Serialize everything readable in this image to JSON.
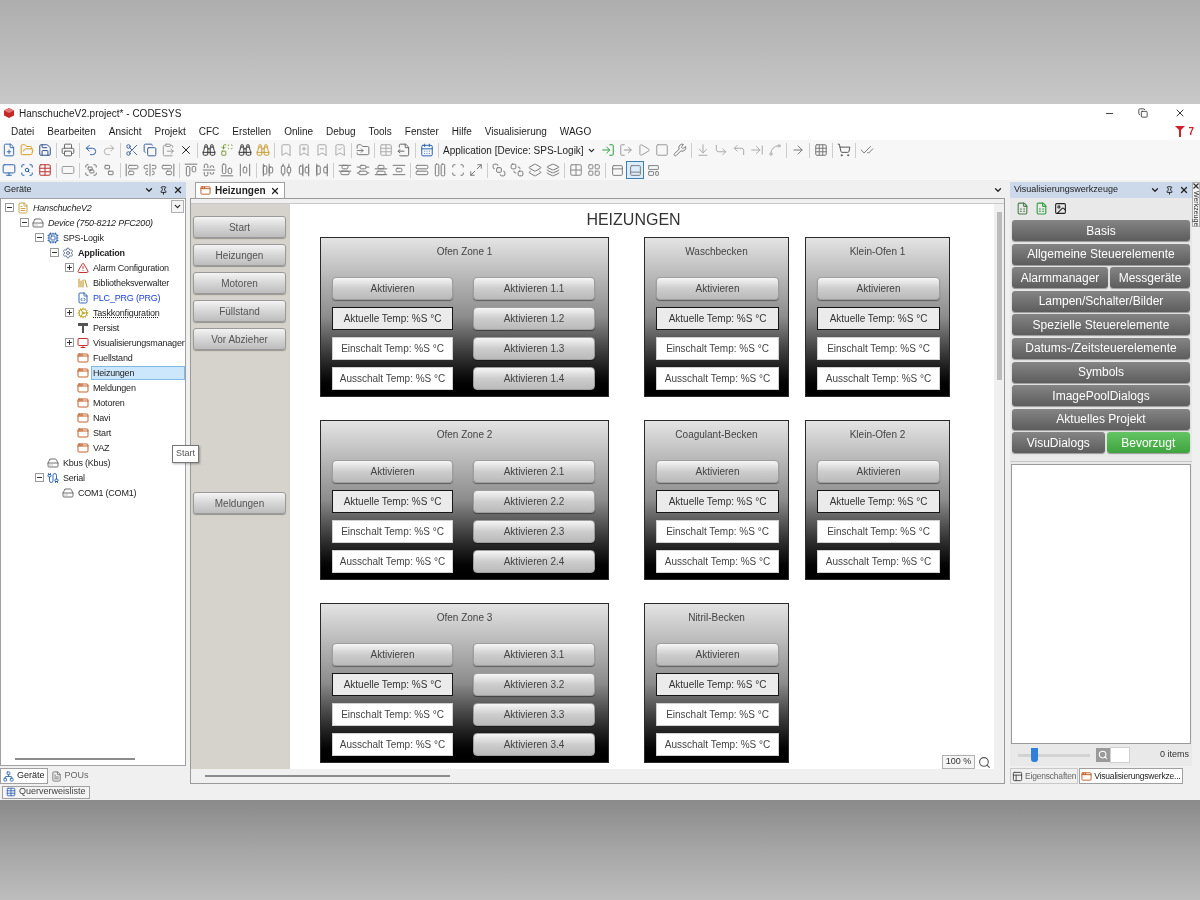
{
  "window": {
    "title": "HanschucheV2.project* - CODESYS"
  },
  "menu_bar": {
    "items": [
      "Datei",
      "Bearbeiten",
      "Ansicht",
      "Projekt",
      "CFC",
      "Erstellen",
      "Online",
      "Debug",
      "Tools",
      "Fenster",
      "Hilfe",
      "Visualisierung",
      "WAGO"
    ],
    "badge": "7"
  },
  "toolbar": {
    "application_selector": "Application [Device: SPS-Logik]",
    "layout_toggles": [
      {
        "selected": false
      },
      {
        "selected": true
      },
      {
        "selected": false
      }
    ]
  },
  "devices_panel": {
    "title": "Geräte",
    "tree": [
      {
        "label": "HanschucheV2",
        "kind": "project",
        "expanded": true,
        "selected": false,
        "children": [
          {
            "label": "Device (750-8212 PFC200)",
            "kind": "device",
            "expanded": true,
            "selected": false,
            "children": [
              {
                "label": "SPS-Logik",
                "kind": "plc-logic",
                "expanded": true,
                "selected": false,
                "children": [
                  {
                    "label": "Application",
                    "kind": "application",
                    "expanded": true,
                    "selected": false,
                    "children": [
                      {
                        "label": "Alarm Configuration",
                        "kind": "alarm",
                        "expanded": false,
                        "selected": false
                      },
                      {
                        "label": "Bibliotheksverwalter",
                        "kind": "library",
                        "selected": false
                      },
                      {
                        "label": "PLC_PRG (PRG)",
                        "kind": "program",
                        "selected": false
                      },
                      {
                        "label": "Taskkonfiguration",
                        "kind": "tasks",
                        "expanded": false,
                        "selected": false
                      },
                      {
                        "label": "Persist",
                        "kind": "persist",
                        "selected": false
                      },
                      {
                        "label": "Visualisierungsmanager",
                        "kind": "visu-manager",
                        "expanded": false,
                        "selected": false
                      },
                      {
                        "label": "Fuellstand",
                        "kind": "visualization",
                        "selected": false
                      },
                      {
                        "label": "Heizungen",
                        "kind": "visualization",
                        "selected": true
                      },
                      {
                        "label": "Meldungen",
                        "kind": "visualization",
                        "selected": false
                      },
                      {
                        "label": "Motoren",
                        "kind": "visualization",
                        "selected": false
                      },
                      {
                        "label": "Navi",
                        "kind": "visualization",
                        "selected": false
                      },
                      {
                        "label": "Start",
                        "kind": "visualization",
                        "selected": false
                      },
                      {
                        "label": "VAZ",
                        "kind": "visualization",
                        "selected": false
                      }
                    ]
                  }
                ]
              },
              {
                "label": "Kbus (Kbus)",
                "kind": "bus",
                "selected": false
              },
              {
                "label": "Serial",
                "kind": "serial",
                "expanded": true,
                "selected": false,
                "children": [
                  {
                    "label": "COM1 (COM1)",
                    "kind": "port",
                    "selected": false
                  }
                ]
              }
            ]
          }
        ]
      }
    ],
    "tabs": [
      {
        "label": "Geräte",
        "selected": true
      },
      {
        "label": "POUs",
        "selected": false
      }
    ]
  },
  "bottom_dock": {
    "tab": "Querverweisliste"
  },
  "tooltip": {
    "text": "Start"
  },
  "editor": {
    "tabs": [
      {
        "label": "Heizungen",
        "selected": true
      }
    ],
    "nav_buttons": [
      "Start",
      "Heizungen",
      "Motoren",
      "Füllstand",
      "Vor Abzieher"
    ],
    "nav_buttons_lower": [
      "Meldungen"
    ],
    "title": "HEIZUNGEN",
    "panel_rows": [
      [
        {
          "title": "Ofen Zone 1",
          "kind": "zone",
          "activate_button": "Aktivieren",
          "fields": [
            {
              "label": "Aktuelle Temp: %S °C",
              "kind": "readout"
            },
            {
              "label": "Einschalt Temp: %S °C",
              "kind": "setpoint"
            },
            {
              "label": "Ausschalt Temp: %S °C",
              "kind": "setpoint"
            }
          ],
          "stage_buttons": [
            "Aktivieren 1.1",
            "Aktivieren 1.2",
            "Aktivieren 1.3",
            "Aktivieren 1.4"
          ]
        },
        {
          "title": "Waschbecken",
          "kind": "unit",
          "activate_button": "Aktivieren",
          "fields": [
            {
              "label": "Aktuelle Temp: %S °C",
              "kind": "readout"
            },
            {
              "label": "Einschalt Temp: %S °C",
              "kind": "setpoint"
            },
            {
              "label": "Ausschalt Temp: %S °C",
              "kind": "setpoint"
            }
          ]
        },
        {
          "title": "Klein-Ofen 1",
          "kind": "unit",
          "activate_button": "Aktivieren",
          "fields": [
            {
              "label": "Aktuelle Temp: %S °C",
              "kind": "readout"
            },
            {
              "label": "Einschalt Temp: %S °C",
              "kind": "setpoint"
            },
            {
              "label": "Ausschalt Temp: %S °C",
              "kind": "setpoint"
            }
          ]
        }
      ],
      [
        {
          "title": "Ofen Zone 2",
          "kind": "zone",
          "activate_button": "Aktivieren",
          "fields": [
            {
              "label": "Aktuelle Temp: %S °C",
              "kind": "readout"
            },
            {
              "label": "Einschalt Temp: %S °C",
              "kind": "setpoint"
            },
            {
              "label": "Ausschalt Temp: %S °C",
              "kind": "setpoint"
            }
          ],
          "stage_buttons": [
            "Aktivieren 2.1",
            "Aktivieren 2.2",
            "Aktivieren 2.3",
            "Aktivieren 2.4"
          ]
        },
        {
          "title": "Coagulant-Becken",
          "kind": "unit",
          "activate_button": "Aktivieren",
          "fields": [
            {
              "label": "Aktuelle Temp: %S °C",
              "kind": "readout"
            },
            {
              "label": "Einschalt Temp: %S °C",
              "kind": "setpoint"
            },
            {
              "label": "Ausschalt Temp: %S °C",
              "kind": "setpoint"
            }
          ]
        },
        {
          "title": "Klein-Ofen 2",
          "kind": "unit",
          "activate_button": "Aktivieren",
          "fields": [
            {
              "label": "Aktuelle Temp: %S °C",
              "kind": "readout"
            },
            {
              "label": "Einschalt Temp: %S °C",
              "kind": "setpoint"
            },
            {
              "label": "Ausschalt Temp: %S °C",
              "kind": "setpoint"
            }
          ]
        }
      ],
      [
        {
          "title": "Ofen Zone 3",
          "kind": "zone",
          "activate_button": "Aktivieren",
          "fields": [
            {
              "label": "Aktuelle Temp: %S °C",
              "kind": "readout"
            },
            {
              "label": "Einschalt Temp: %S °C",
              "kind": "setpoint"
            },
            {
              "label": "Ausschalt Temp: %S °C",
              "kind": "setpoint"
            }
          ],
          "stage_buttons": [
            "Aktivieren 3.1",
            "Aktivieren 3.2",
            "Aktivieren 3.3",
            "Aktivieren 3.4"
          ]
        },
        {
          "title": "Nitril-Becken",
          "kind": "unit",
          "activate_button": "Aktivieren",
          "fields": [
            {
              "label": "Aktuelle Temp: %S °C",
              "kind": "readout"
            },
            {
              "label": "Einschalt Temp: %S °C",
              "kind": "setpoint"
            },
            {
              "label": "Ausschalt Temp: %S °C",
              "kind": "setpoint"
            }
          ]
        }
      ]
    ],
    "zoom": "100 %"
  },
  "toolbox_panel": {
    "title": "Visualisierungswerkzeuge",
    "category_rows": [
      [
        {
          "label": "Basis",
          "selected": false
        }
      ],
      [
        {
          "label": "Allgemeine Steuerelemente",
          "selected": false
        }
      ],
      [
        {
          "label": "Alarmmanager",
          "selected": false
        },
        {
          "label": "Messgeräte",
          "selected": false
        }
      ],
      [
        {
          "label": "Lampen/Schalter/Bilder",
          "selected": false
        }
      ],
      [
        {
          "label": "Spezielle Steuerelemente",
          "selected": false
        }
      ],
      [
        {
          "label": "Datums-/Zeitsteuerelemente",
          "selected": false
        }
      ],
      [
        {
          "label": "Symbols",
          "selected": false
        }
      ],
      [
        {
          "label": "ImagePoolDialogs",
          "selected": false
        }
      ],
      [
        {
          "label": "Aktuelles Projekt",
          "selected": false
        }
      ],
      [
        {
          "label": "VisuDialogs",
          "selected": false
        },
        {
          "label": "Bevorzugt",
          "selected": true
        }
      ]
    ],
    "zoom_slider": {
      "level": 0.2
    },
    "item_count": "0 items",
    "tabs": [
      {
        "label": "Eigenschaften",
        "selected": false
      },
      {
        "label": "Visualisierungswerkze...",
        "selected": true
      }
    ]
  },
  "side_tab": {
    "label": "Werkzeuge"
  }
}
